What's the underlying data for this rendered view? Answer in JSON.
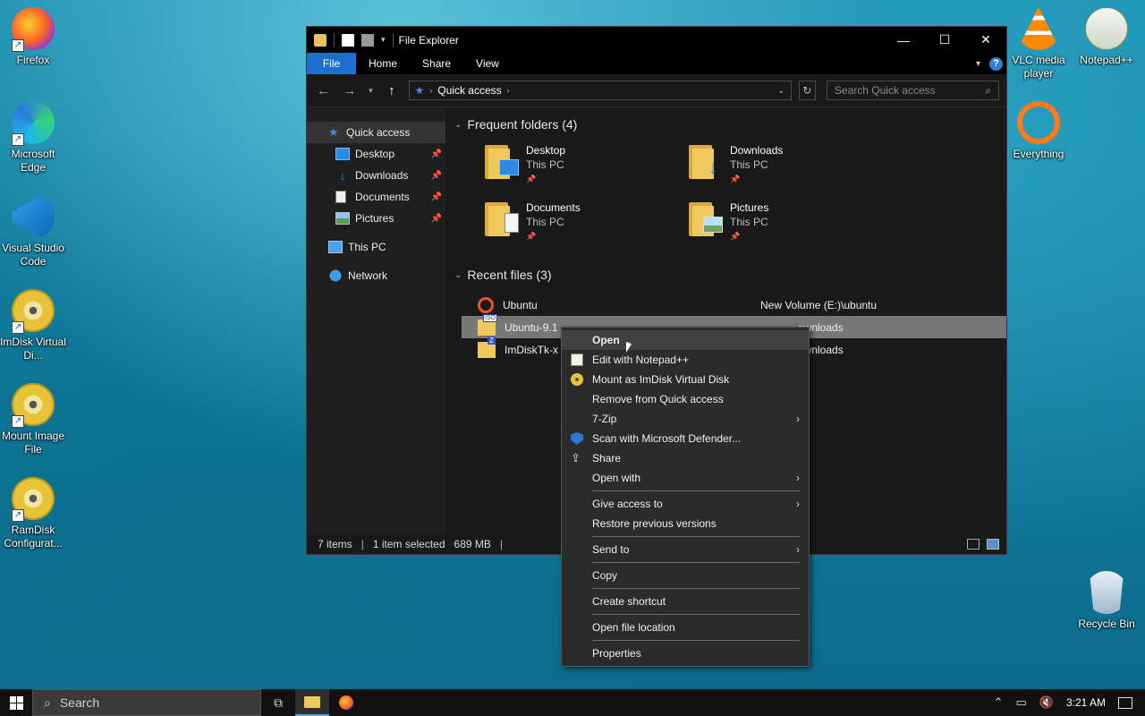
{
  "desktop": {
    "left_icons": [
      {
        "label": "Firefox",
        "icon": "firefox-icon"
      },
      {
        "label": "Microsoft Edge",
        "icon": "edge-icon"
      },
      {
        "label": "Visual Studio Code",
        "icon": "vscode-icon"
      },
      {
        "label": "ImDisk Virtual Di...",
        "icon": "imdisk-icon"
      },
      {
        "label": "Mount Image File",
        "icon": "mount-image-icon"
      },
      {
        "label": "RamDisk Configurat...",
        "icon": "ramdisk-icon"
      }
    ],
    "right_icons": [
      {
        "label": "VLC media player",
        "icon": "vlc-icon"
      },
      {
        "label": "Notepad++",
        "icon": "notepadpp-icon"
      },
      {
        "label": "Everything",
        "icon": "everything-icon"
      },
      {
        "label": "Recycle Bin",
        "icon": "recycle-bin-icon"
      }
    ]
  },
  "explorer": {
    "title": "File Explorer",
    "window_controls": {
      "minimize": "—",
      "maximize": "☐",
      "close": "✕"
    },
    "ribbon_tabs": [
      "File",
      "Home",
      "Share",
      "View"
    ],
    "help_label": "?",
    "address": {
      "location": "Quick access"
    },
    "search": {
      "placeholder": "Search Quick access"
    },
    "nav_pane": [
      {
        "label": "Quick access",
        "icon": "star-icon",
        "pinned": false
      },
      {
        "label": "Desktop",
        "icon": "desktop-icon",
        "pinned": true
      },
      {
        "label": "Downloads",
        "icon": "downloads-icon",
        "pinned": true
      },
      {
        "label": "Documents",
        "icon": "documents-icon",
        "pinned": true
      },
      {
        "label": "Pictures",
        "icon": "pictures-icon",
        "pinned": true
      },
      {
        "label": "This PC",
        "icon": "this-pc-icon",
        "pinned": false
      },
      {
        "label": "Network",
        "icon": "network-icon",
        "pinned": false
      }
    ],
    "frequent": {
      "title": "Frequent folders (4)",
      "folders": [
        {
          "name": "Desktop",
          "location": "This PC"
        },
        {
          "name": "Downloads",
          "location": "This PC"
        },
        {
          "name": "Documents",
          "location": "This PC"
        },
        {
          "name": "Pictures",
          "location": "This PC"
        }
      ]
    },
    "recent": {
      "title": "Recent files (3)",
      "files": [
        {
          "name": "Ubuntu",
          "location": "New Volume (E:)\\ubuntu"
        },
        {
          "name": "Ubuntu-9.1",
          "location": "ownloads"
        },
        {
          "name": "ImDiskTk-x",
          "location": "ownloads"
        }
      ]
    },
    "status": {
      "items": "7 items",
      "selected": "1 item selected",
      "size": "689 MB"
    }
  },
  "context_menu": {
    "groups": [
      [
        {
          "label": "Open",
          "bold": true,
          "icon": ""
        },
        {
          "label": "Edit with Notepad++",
          "icon": "notepadpp-icon"
        },
        {
          "label": "Mount as ImDisk Virtual Disk",
          "icon": "imdisk-icon"
        },
        {
          "label": "Remove from Quick access",
          "icon": ""
        },
        {
          "label": "7-Zip",
          "icon": "",
          "submenu": true
        },
        {
          "label": "Scan with Microsoft Defender...",
          "icon": "defender-icon"
        },
        {
          "label": "Share",
          "icon": "share-icon"
        },
        {
          "label": "Open with",
          "icon": "",
          "submenu": true
        }
      ],
      [
        {
          "label": "Give access to",
          "icon": "",
          "submenu": true
        },
        {
          "label": "Restore previous versions",
          "icon": ""
        }
      ],
      [
        {
          "label": "Send to",
          "icon": "",
          "submenu": true
        }
      ],
      [
        {
          "label": "Copy",
          "icon": ""
        }
      ],
      [
        {
          "label": "Create shortcut",
          "icon": ""
        }
      ],
      [
        {
          "label": "Open file location",
          "icon": ""
        }
      ],
      [
        {
          "label": "Properties",
          "icon": ""
        }
      ]
    ]
  },
  "taskbar": {
    "search_label": "Search",
    "time": "3:21 AM"
  }
}
